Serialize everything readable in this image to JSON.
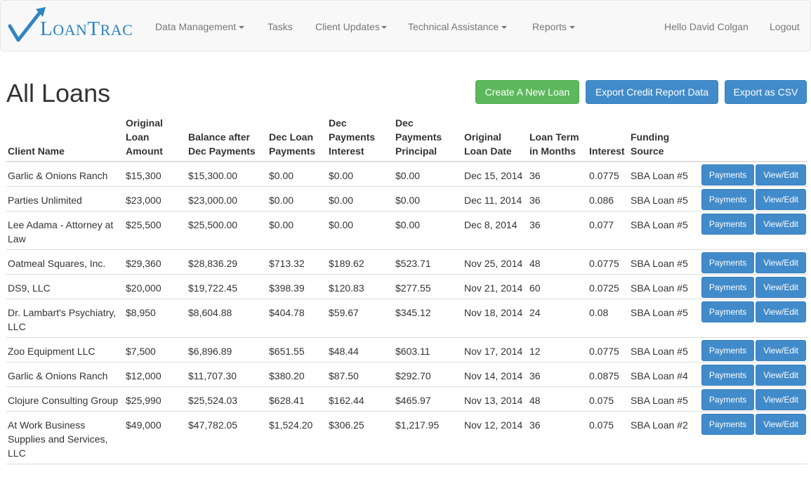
{
  "brand": {
    "name_first": "L",
    "name_rest": "OAN",
    "name_second": "T",
    "name_second_rest": "RAC",
    "color": "#2e86c1"
  },
  "nav": {
    "items": [
      {
        "label": "Data Management",
        "caret": true
      },
      {
        "label": "Tasks",
        "caret": false
      },
      {
        "label": "Client Updates",
        "caret": true
      },
      {
        "label": "Technical Assistance",
        "caret": true
      },
      {
        "label": "Reports",
        "caret": true
      }
    ],
    "greeting": "Hello David Colgan",
    "logout": "Logout"
  },
  "page": {
    "title": "All Loans",
    "buttons": {
      "create": "Create A New Loan",
      "export_credit": "Export Credit Report Data",
      "export_csv": "Export as CSV"
    }
  },
  "table": {
    "headers": {
      "client_name": "Client Name",
      "original_amount": "Original Loan Amount",
      "balance": "Balance after Dec Payments",
      "dec_payments": "Dec Loan Payments",
      "dec_interest": "Dec Payments Interest",
      "dec_principal": "Dec Payments Principal",
      "original_date": "Original Loan Date",
      "term": "Loan Term in Months",
      "interest": "Interest",
      "funding": "Funding Source"
    },
    "payments_label": "Payments",
    "view_label": "View/Edit",
    "rows": [
      [
        "Garlic & Onions Ranch",
        "$15,300",
        "$15,300.00",
        "$0.00",
        "$0.00",
        "$0.00",
        "Dec 15, 2014",
        "36",
        "0.0775",
        "SBA Loan #5"
      ],
      [
        "Parties Unlimited",
        "$23,000",
        "$23,000.00",
        "$0.00",
        "$0.00",
        "$0.00",
        "Dec 11, 2014",
        "36",
        "0.086",
        "SBA Loan #5"
      ],
      [
        "Lee Adama - Attorney at Law",
        "$25,500",
        "$25,500.00",
        "$0.00",
        "$0.00",
        "$0.00",
        "Dec 8, 2014",
        "36",
        "0.077",
        "SBA Loan #5"
      ],
      [
        "Oatmeal Squares, Inc.",
        "$29,360",
        "$28,836.29",
        "$713.32",
        "$189.62",
        "$523.71",
        "Nov 25, 2014",
        "48",
        "0.0775",
        "SBA Loan #5"
      ],
      [
        "DS9, LLC",
        "$20,000",
        "$19,722.45",
        "$398.39",
        "$120.83",
        "$277.55",
        "Nov 21, 2014",
        "60",
        "0.0725",
        "SBA Loan #5"
      ],
      [
        "Dr. Lambart's Psychiatry, LLC",
        "$8,950",
        "$8,604.88",
        "$404.78",
        "$59.67",
        "$345.12",
        "Nov 18, 2014",
        "24",
        "0.08",
        "SBA Loan #5"
      ],
      [
        "Zoo Equipment LLC",
        "$7,500",
        "$6,896.89",
        "$651.55",
        "$48.44",
        "$603.11",
        "Nov 17, 2014",
        "12",
        "0.0775",
        "SBA Loan #5"
      ],
      [
        "Garlic & Onions Ranch",
        "$12,000",
        "$11,707.30",
        "$380.20",
        "$87.50",
        "$292.70",
        "Nov 14, 2014",
        "36",
        "0.0875",
        "SBA Loan #4"
      ],
      [
        "Clojure Consulting Group",
        "$25,990",
        "$25,524.03",
        "$628.41",
        "$162.44",
        "$465.97",
        "Nov 13, 2014",
        "48",
        "0.075",
        "SBA Loan #5"
      ],
      [
        "At Work Business Supplies and Services, LLC",
        "$49,000",
        "$47,782.05",
        "$1,524.20",
        "$306.25",
        "$1,217.95",
        "Nov 12, 2014",
        "36",
        "0.075",
        "SBA Loan #2"
      ]
    ]
  }
}
